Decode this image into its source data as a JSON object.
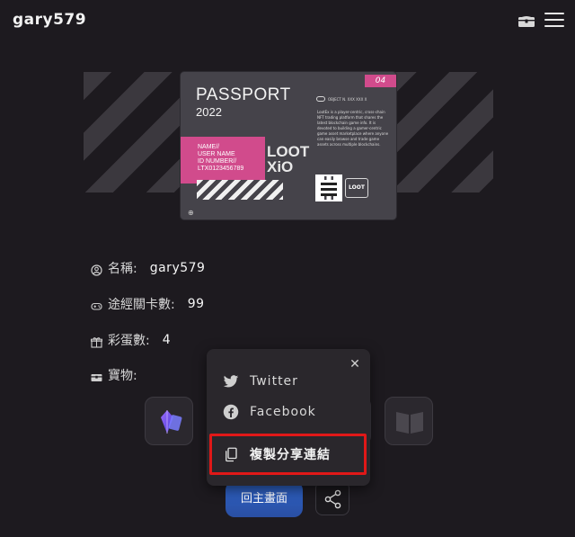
{
  "header": {
    "username": "gary579",
    "chest_icon": "treasure-chest-icon",
    "menu_icon": "hamburger-menu-icon"
  },
  "passport_card": {
    "title": "PASSPORT",
    "year": "2022",
    "id_lines": [
      "NAME//",
      "USER NAME",
      "ID NUMBER//",
      "LTX0123456789"
    ],
    "loot_text_top": "LOOT",
    "loot_text_bottom": "XiO",
    "tag": "04",
    "small_header": "OBJECT N. XXX XXX X",
    "blurb": "LootEx is a player-centric, cross-chain NFT trading platform that shares the latest blockchain game info. It is devoted to building a gamer-centric game asset marketplace where anyone can easily browse and trade game assets across multiple blockchains.",
    "badge": "LOOT"
  },
  "profile": {
    "name_label": "名稱:",
    "name_value": "gary579",
    "levels_label": "途經關卡數:",
    "levels_value": "99",
    "eggs_label": "彩蛋數:",
    "eggs_value": "4",
    "treasure_label": "寶物:"
  },
  "share_popup": {
    "close_icon": "close-icon",
    "items": [
      {
        "label": "Twitter",
        "icon": "twitter-icon"
      },
      {
        "label": "Facebook",
        "icon": "facebook-icon"
      },
      {
        "label": "複製分享連結",
        "icon": "copy-icon"
      }
    ],
    "highlight_color": "#e01818"
  },
  "buttons": {
    "home_label": "回主畫面",
    "share_icon": "share-icon"
  },
  "colors": {
    "background": "#1d1a1f",
    "accent_blue": "#2e63c7",
    "accent_pink": "#d14b8c"
  }
}
